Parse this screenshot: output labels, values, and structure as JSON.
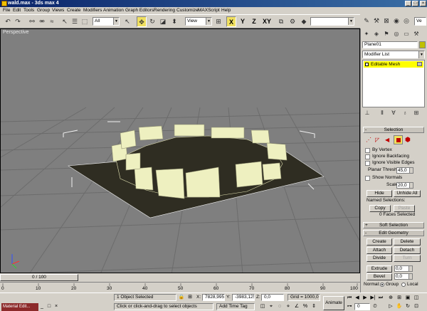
{
  "window": {
    "title": "wald.max - 3ds max 4",
    "btn_min": "_",
    "btn_max": "□",
    "btn_close": "×"
  },
  "menu": [
    "File",
    "Edit",
    "Tools",
    "Group",
    "Views",
    "Create",
    "Modifiers",
    "Animation",
    "Graph Editors",
    "Rendering",
    "Customize",
    "MAXScript",
    "Help"
  ],
  "toolbar": {
    "selection_filter": "All",
    "ref_coord": "View",
    "axis_x": "X",
    "axis_y": "Y",
    "axis_z": "Z",
    "axis_xy": "XY",
    "named_sel": "",
    "ve": "Ve"
  },
  "viewport": {
    "label": "Perspective"
  },
  "command_panel": {
    "object_name": "Plane01",
    "modifier_list": "Modifier List",
    "stack_item": "Editable Mesh",
    "selection": {
      "header": "Selection",
      "by_vertex": "By Vertex",
      "ignore_backfacing": "Ignore Backfacing",
      "ignore_visible_edges": "Ignore Visible Edges",
      "planar_thresh_label": "Planar Thresh:",
      "planar_thresh_value": "45,0",
      "show_normals": "Show Normals",
      "scale_label": "Scale:",
      "scale_value": "20,0",
      "hide": "Hide",
      "unhide_all": "Unhide All",
      "named_selections": "Named Selections:",
      "copy": "Copy",
      "paste": "Paste",
      "faces_selected": "0 Faces Selected"
    },
    "soft_selection": {
      "header": "Soft Selection"
    },
    "edit_geometry": {
      "header": "Edit Geometry",
      "create": "Create",
      "delete": "Delete",
      "attach": "Attach",
      "detach": "Detach",
      "divide": "Divide",
      "turn": "Turn",
      "extrude": "Extrude",
      "extrude_value": "0,0",
      "bevel": "Bevel",
      "bevel_value": "0,0",
      "normal_label": "Normal:",
      "group": "Group",
      "local": "Local"
    }
  },
  "timeline": {
    "frame": "0 / 100",
    "ticks": [
      "0",
      "10",
      "20",
      "30",
      "40",
      "50",
      "60",
      "70",
      "80",
      "90",
      "100"
    ]
  },
  "statusbar": {
    "material_editor": "Material Edit...",
    "selection_info": "1 Object Selected",
    "prompt": "Click or click-and-drag to select objects",
    "x_label": "X:",
    "x_value": "7828,995",
    "y_label": "Y:",
    "y_value": "-3983,125",
    "z_label": "Z:",
    "z_value": "0,0",
    "grid": "Grid = 1000,0",
    "add_time_tag": "Add Time Tag",
    "animate": "Animate",
    "current_frame": "0"
  },
  "colors": {
    "title_start": "#0a246a",
    "title_end": "#3a6ea5",
    "viewport_bg": "#7f7f7f",
    "grid_line": "#6c6c6c",
    "plane": "#2f2d22",
    "box_face": "#eef0c0",
    "stack_highlight": "#ffff00",
    "active_tool": "#f0e060"
  }
}
